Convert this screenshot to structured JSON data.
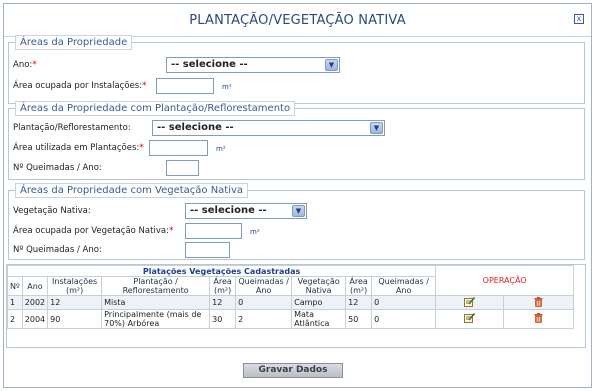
{
  "dialog": {
    "title": "PLANTAÇÃO/VEGETAÇÃO NATIVA",
    "close_glyph": "x"
  },
  "areas_propriedade": {
    "legend": "Áreas da Propriedade",
    "ano_label": "Ano:",
    "ano_value": "-- selecione --",
    "area_instalacoes_label": "Área ocupada por Instalações:",
    "area_instalacoes_value": "",
    "unit": "m²"
  },
  "plantacao": {
    "legend": "Áreas da Propriedade com Plantação/Reflorestamento",
    "plantacao_label": "Plantação/Reflorestamento:",
    "plantacao_value": "-- selecione --",
    "area_label": "Área utilizada em Plantações:",
    "area_value": "",
    "unit": "m²",
    "queimadas_label": "Nº Queimadas / Ano:",
    "queimadas_value": ""
  },
  "vegetacao": {
    "legend": "Áreas da Propriedade com Vegetação Nativa",
    "vegetacao_label": "Vegetação Nativa:",
    "vegetacao_value": "-- selecione --",
    "area_label": "Área ocupada por Vegetação Nativa:",
    "area_value": "",
    "unit": "m²",
    "queimadas_label": "Nº Queimadas / Ano:",
    "queimadas_value": ""
  },
  "required_mark": "*",
  "table": {
    "caption": "Platações Vegetações Cadastradas",
    "operation_header": "OPERAÇÃO",
    "headers": [
      "Nº",
      "Ano",
      "Instalações (m²)",
      "Plantação / Reflorestamento",
      "Área (m²)",
      "Queimadas / Ano",
      "Vegetação Nativa",
      "Área (m²)",
      "Queimadas / Ano"
    ],
    "rows": [
      [
        "1",
        "2002",
        "12",
        "Mista",
        "12",
        "0",
        "Campo",
        "12",
        "0"
      ],
      [
        "2",
        "2004",
        "90",
        "Principalmente (mais de 70%) Arbórea",
        "30",
        "2",
        "Mata Atlântica",
        "50",
        "0"
      ]
    ],
    "edit_icon": "edit-icon",
    "delete_icon": "trash-icon"
  },
  "save_button": "Gravar Dados",
  "colors": {
    "title": "#2a4a7a",
    "legend": "#3b5c8e",
    "caption": "#1f3f8f",
    "operation": "#dd2222",
    "required": "#dd0000"
  }
}
